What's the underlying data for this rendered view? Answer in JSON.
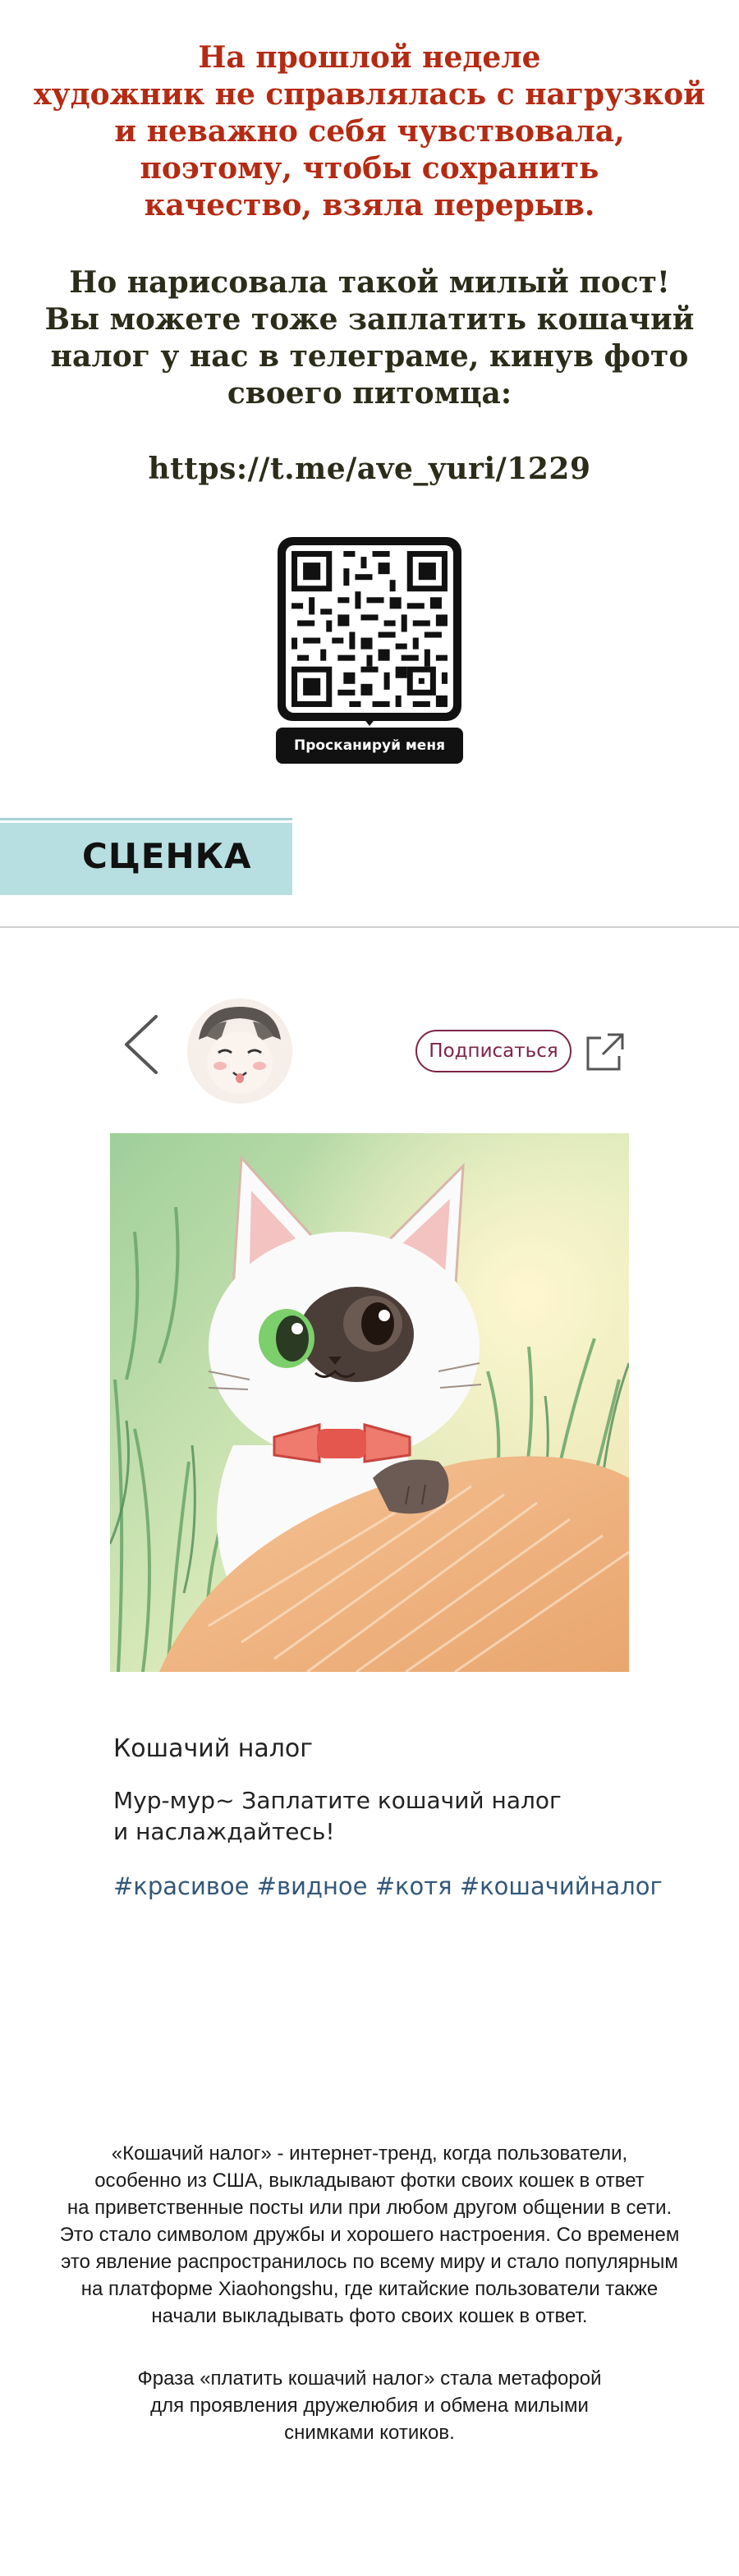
{
  "note": {
    "red_lines": [
      "На прошлой неделе",
      "художник не справлялась с нагрузкой",
      "и неважно себя чувствовала,",
      "поэтому, чтобы сохранить",
      "качество, взяла перерыв."
    ],
    "dark_lines": [
      "Но нарисовала такой милый пост!",
      "Вы можете тоже заплатить кошачий",
      "налог у нас в телеграме, кинув фото",
      "своего питомца:"
    ],
    "link": "https://t.me/ave_yuri/1229"
  },
  "qr": {
    "caption": "Просканируй меня"
  },
  "banner": {
    "label": "СЦЕНКА"
  },
  "post": {
    "follow_label": "Подписаться",
    "title": "Кошачий налог",
    "body": "Мур-мур~ Заплатите кошачий налог и наслаждайтесь!",
    "tags": "#красивое #видное #котя #кошачийналог"
  },
  "explanation": {
    "paragraph1": [
      "«Кошачий налог» - интернет-тренд, когда пользователи,",
      "особенно из США, выкладывают фотки своих кошек в ответ",
      "на приветственные посты или при любом другом общении в сети.",
      "Это стало символом дружбы и хорошего настроения. Со временем",
      "это явление распространилось по всему миру и стало популярным",
      "на платформе Xiaohongshu, где китайские пользователи также",
      "начали выкладывать фото своих кошек в ответ."
    ],
    "paragraph2": [
      "Фраза «платить кошачий налог» стала метафорой",
      "для проявления дружелюбия и обмена милыми",
      "снимками котиков."
    ]
  },
  "colors": {
    "note_red": "#b52a12",
    "note_dark": "#2c2c1a",
    "banner_bg": "#b7dfe1",
    "follow_accent": "#7e2347",
    "tag_blue": "#33587a"
  },
  "icons": [
    "qr-code-icon",
    "back-chevron-icon",
    "share-icon",
    "avatar-image",
    "cat-illustration"
  ]
}
